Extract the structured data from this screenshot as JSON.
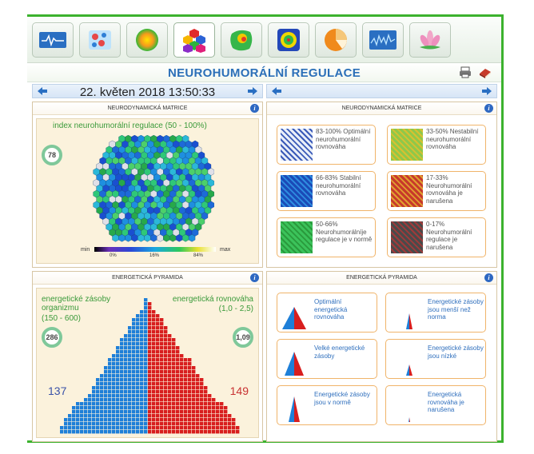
{
  "header": {
    "title": "NEUROHUMORÁLNÍ REGULACE"
  },
  "toolbar": {
    "buttons": [
      "ecg-icon",
      "cells-icon",
      "sphere-icon",
      "hexagons-icon",
      "heatmap-icon",
      "face-icon",
      "pie-icon",
      "waveform-icon",
      "lotus-icon"
    ],
    "active": 3
  },
  "datebar": {
    "left_date": "22. květen 2018 13:50:33",
    "right_date": ""
  },
  "panels": {
    "matrix_title": "NEURODYNAMICKÁ MATRICE",
    "matrix_legend_title": "NEURODYNAMICKÁ MATRICE",
    "pyramid_title": "ENERGETICKÁ PYRAMIDA",
    "pyramid_legend_title": "ENERGETICKÁ PYRAMIDA"
  },
  "matrix": {
    "index_label": "index neurohumorální regulace (50 - 100%)",
    "index_value": "78",
    "scale_min": "min",
    "scale_max": "max",
    "scale_ticks": [
      "0%",
      "16%",
      "84%"
    ]
  },
  "matrix_legend": [
    {
      "range": "83-100%",
      "text": "Optimální neurohumorální rovnováha"
    },
    {
      "range": "33-50%",
      "text": "Nestabilní neurohumorální rovnováha"
    },
    {
      "range": "66-83%",
      "text": "Stabilní neurohumorální rovnováha"
    },
    {
      "range": "17-33%",
      "text": "Neurohumorální rovnováha je narušena"
    },
    {
      "range": "50-66%",
      "text": "Neurohumorálníje regulace je v normě"
    },
    {
      "range": "0-17%",
      "text": "Neurohumorální regulace je narušena"
    }
  ],
  "pyramid": {
    "left_label": "energetické zásoby organizmu",
    "left_range": "(150 - 600)",
    "left_gauge": "286",
    "right_label": "energetická rovnováha",
    "right_range": "(1,0 - 2,5)",
    "right_gauge": "1,09",
    "left_count": "137",
    "right_count": "149"
  },
  "pyramid_legend": [
    {
      "text": "Optimální energetická rovnováha"
    },
    {
      "text": "Energetické zásoby jsou menší než norma"
    },
    {
      "text": "Velké energetické zásoby"
    },
    {
      "text": "Energetické zásoby jsou nízké"
    },
    {
      "text": "Energetické zásoby jsou v normě"
    },
    {
      "text": "Energetická rovnováha je narušena"
    }
  ],
  "colors": {
    "accent": "#2b6fb8",
    "frame": "#3cb22e",
    "blue": "#1e7fd8",
    "red": "#d81e1e"
  }
}
